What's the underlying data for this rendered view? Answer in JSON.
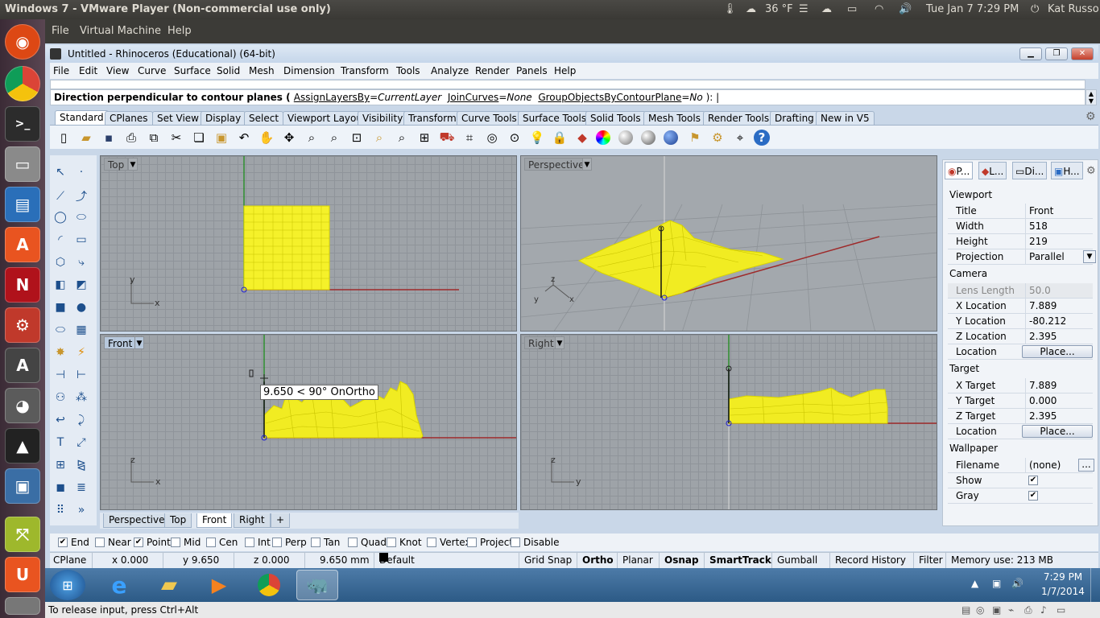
{
  "host": {
    "title": "Windows 7 - VMware Player (Non-commercial use only)",
    "temperature": "36 °F",
    "datetime": "Tue Jan  7   7:29 PM",
    "user": "Kat Russo",
    "menu": [
      "File",
      "Virtual Machine",
      "Help"
    ],
    "release_hint": "To release input, press Ctrl+Alt"
  },
  "rhino": {
    "title": "Untitled - Rhinoceros (Educational) (64-bit)",
    "menu": [
      "File",
      "Edit",
      "View",
      "Curve",
      "Surface",
      "Solid",
      "Mesh",
      "Dimension",
      "Transform",
      "Tools",
      "Analyze",
      "Render",
      "Panels",
      "Help"
    ],
    "command": {
      "prompt": "Direction perpendicular to contour planes ( ",
      "opt1_name": "AssignLayersBy",
      "opt1_val": "CurrentLayer",
      "opt2_name": "JoinCurves",
      "opt2_val": "None",
      "opt3_name": "GroupObjectsByContourPlane",
      "opt3_val": "No",
      "suffix": " ):"
    },
    "toolbar_tabs": [
      "Standard",
      "CPlanes",
      "Set View",
      "Display",
      "Select",
      "Viewport Layout",
      "Visibility",
      "Transform",
      "Curve Tools",
      "Surface Tools",
      "Solid Tools",
      "Mesh Tools",
      "Render Tools",
      "Drafting",
      "New in V5"
    ],
    "viewports": {
      "top": "Top",
      "perspective": "Perspective",
      "front": "Front",
      "right": "Right",
      "tracking_tooltip": "9.650 < 90° OnOrtho"
    },
    "viewport_tabs": [
      "Perspective",
      "Top",
      "Front",
      "Right"
    ],
    "panel": {
      "tabs": [
        "P...",
        "L...",
        "Di...",
        "H..."
      ],
      "viewport_section": "Viewport",
      "title_label": "Title",
      "title_val": "Front",
      "width_label": "Width",
      "width_val": "518",
      "height_label": "Height",
      "height_val": "219",
      "projection_label": "Projection",
      "projection_val": "Parallel",
      "camera_section": "Camera",
      "lens_label": "Lens Length",
      "lens_val": "50.0",
      "xloc_label": "X Location",
      "xloc_val": "7.889",
      "yloc_label": "Y Location",
      "yloc_val": "-80.212",
      "zloc_label": "Z Location",
      "zloc_val": "2.395",
      "loc_label": "Location",
      "place_btn": "Place...",
      "target_section": "Target",
      "xt_label": "X Target",
      "xt_val": "7.889",
      "yt_label": "Y Target",
      "yt_val": "0.000",
      "zt_label": "Z Target",
      "zt_val": "2.395",
      "tloc_label": "Location",
      "tplace_btn": "Place...",
      "wall_section": "Wallpaper",
      "file_label": "Filename",
      "file_val": "(none)",
      "file_btn": "...",
      "show_label": "Show",
      "gray_label": "Gray"
    },
    "osnaps": [
      {
        "label": "End",
        "checked": true
      },
      {
        "label": "Near",
        "checked": false
      },
      {
        "label": "Point",
        "checked": true
      },
      {
        "label": "Mid",
        "checked": false
      },
      {
        "label": "Cen",
        "checked": false
      },
      {
        "label": "Int",
        "checked": false
      },
      {
        "label": "Perp",
        "checked": false
      },
      {
        "label": "Tan",
        "checked": false
      },
      {
        "label": "Quad",
        "checked": false
      },
      {
        "label": "Knot",
        "checked": false
      },
      {
        "label": "Vertex",
        "checked": false
      },
      {
        "label": "Project",
        "checked": false
      },
      {
        "label": "Disable",
        "checked": false
      }
    ],
    "status": {
      "cplane": "CPlane",
      "x": "x 0.000",
      "y": "y 9.650",
      "z": "z 0.000",
      "dist": "9.650 mm",
      "layer": "Default",
      "grid_snap": "Grid Snap",
      "ortho": "Ortho",
      "planar": "Planar",
      "osnap": "Osnap",
      "smarttrack": "SmartTrack",
      "gumball": "Gumball",
      "history": "Record History",
      "filter": "Filter",
      "memory": "Memory use: 213 MB"
    }
  },
  "guest_taskbar": {
    "time": "7:29 PM",
    "date": "1/7/2014"
  }
}
